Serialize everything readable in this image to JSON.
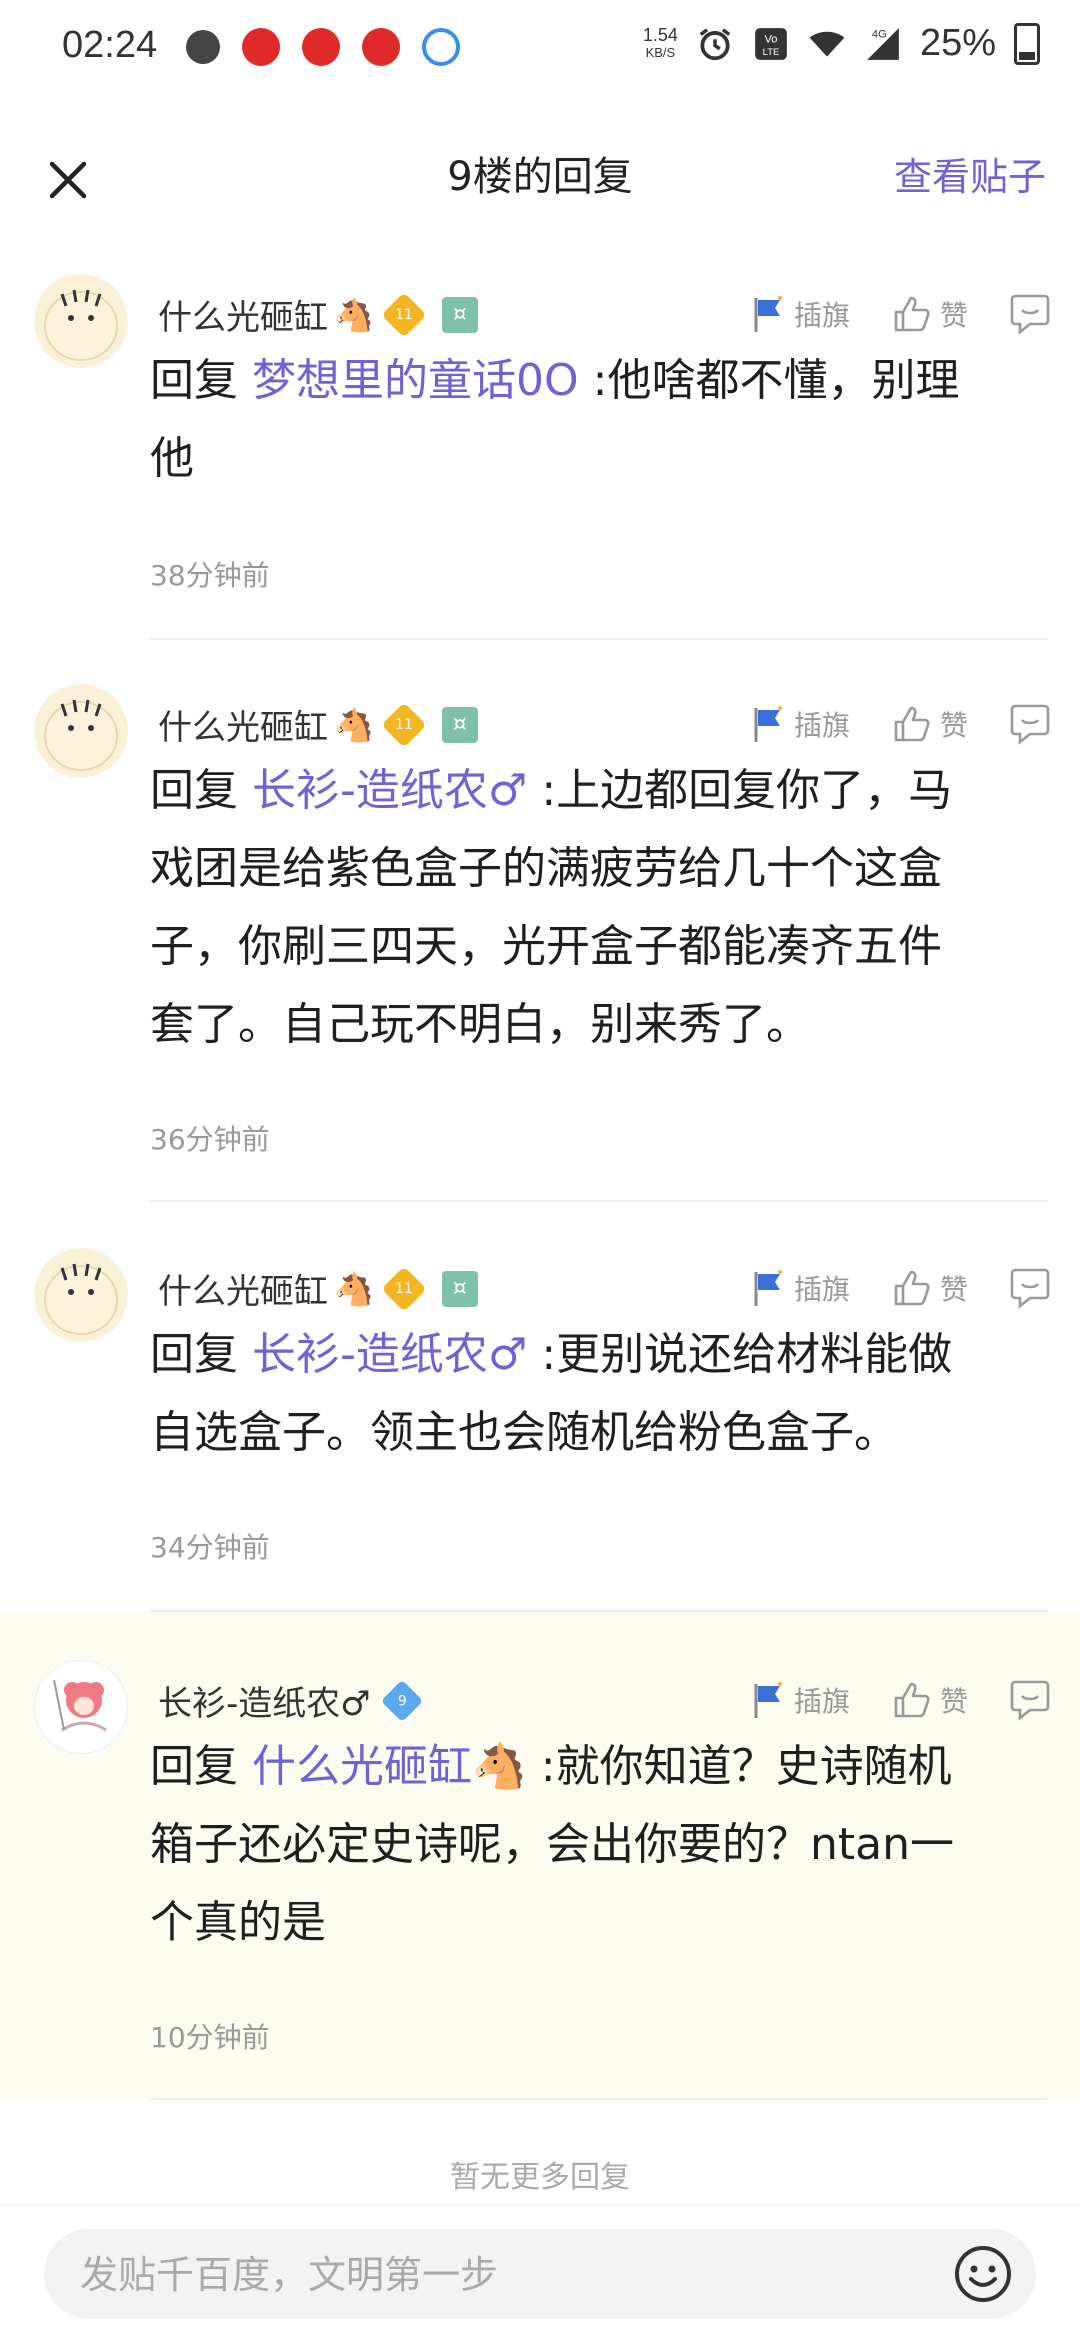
{
  "status_bar": {
    "time": "02:24",
    "speed_value": "1.54",
    "speed_unit": "KB/S",
    "battery": "25%"
  },
  "header": {
    "title": "9楼的回复",
    "view_post": "查看贴子"
  },
  "actions": {
    "flag_label": "插旗",
    "like_label": "赞"
  },
  "replies": [
    {
      "username": "什么光砸缸",
      "level": "11",
      "prefix": "回复 ",
      "mention": "梦想里的童话0O",
      "text_line1": ":他啥都不懂，别理",
      "text_line2": "他",
      "time": "38分钟前"
    },
    {
      "username": "什么光砸缸",
      "level": "11",
      "prefix": "回复 ",
      "mention": "长衫-造纸农♂",
      "text_line1": ":上边都回复你了，马",
      "text_line2": "戏团是给紫色盒子的满疲劳给几十个这盒",
      "text_line3": "子，你刷三四天，光开盒子都能凑齐五件",
      "text_line4": "套了。自己玩不明白，别来秀了。",
      "time": "36分钟前"
    },
    {
      "username": "什么光砸缸",
      "level": "11",
      "prefix": "回复 ",
      "mention": "长衫-造纸农♂",
      "text_line1": ":更别说还给材料能做",
      "text_line2": "自选盒子。领主也会随机给粉色盒子。",
      "time": "34分钟前"
    },
    {
      "username": "长衫-造纸农♂",
      "level": "9",
      "prefix": "回复 ",
      "mention": "什么光砸缸🐴",
      "text_line1": ":就你知道？史诗随机",
      "text_line2": "箱子还必定史诗呢，会出你要的？ntan一",
      "text_line3": "个真的是",
      "time": "10分钟前"
    }
  ],
  "no_more": "暂无更多回复",
  "input": {
    "placeholder": "发贴千百度，文明第一步"
  },
  "colors": {
    "accent": "#6f62d2",
    "highlight_bg": "#fdfcf0"
  }
}
